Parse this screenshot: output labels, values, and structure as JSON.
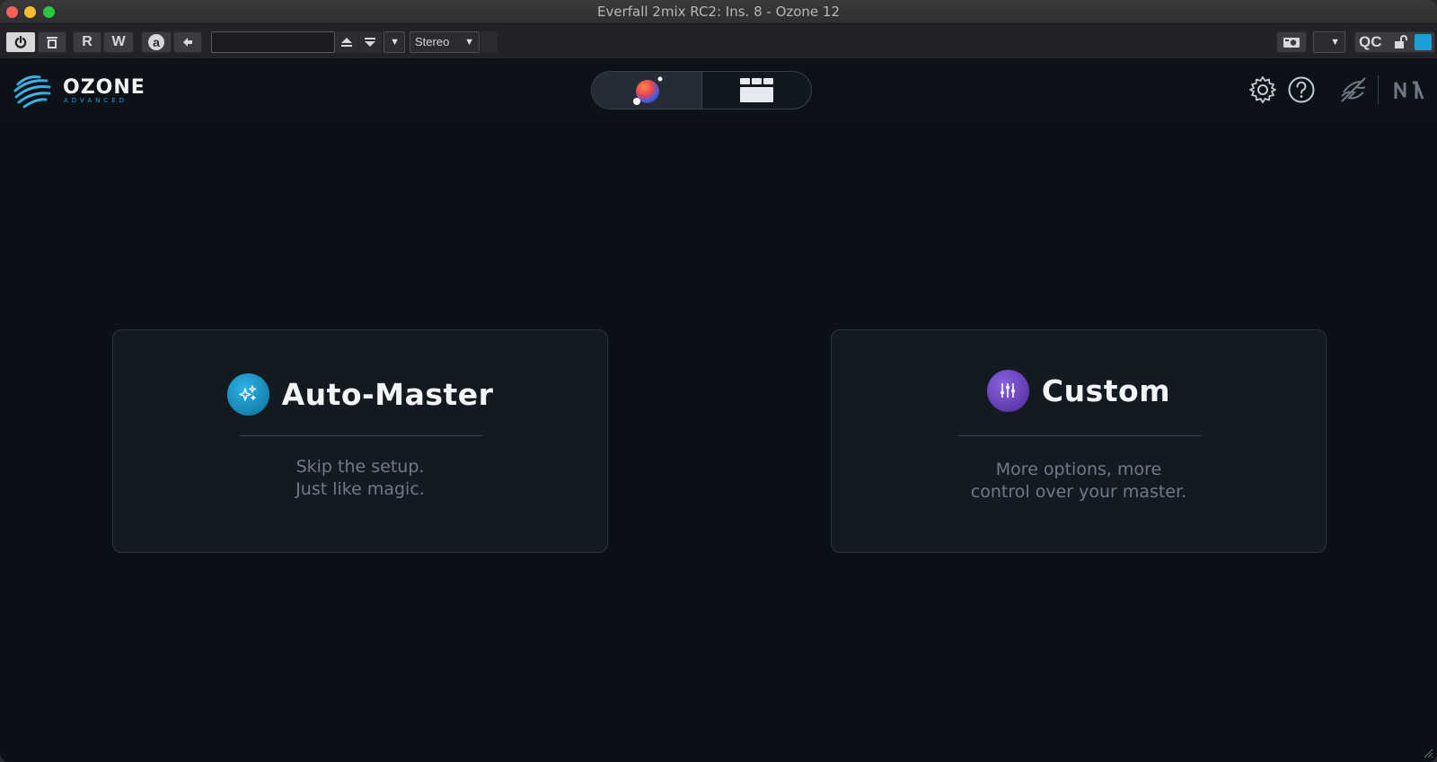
{
  "window": {
    "title": "Everfall 2mix RC2: Ins. 8 - Ozone 12"
  },
  "host_toolbar": {
    "read_label": "R",
    "write_label": "W",
    "auto_label": "a",
    "preset_value": "",
    "channel_mode": "Stereo",
    "compare_label": "QC",
    "accent_color": "#1a9fd6"
  },
  "plugin_header": {
    "logo_text": "OZONE",
    "logo_subtext": "ADVANCED",
    "modes": [
      {
        "name": "assistant",
        "icon": "orb-icon",
        "selected": true
      },
      {
        "name": "modules",
        "icon": "modules-grid-icon",
        "selected": false
      }
    ],
    "right_icons": [
      "gear-icon",
      "help-icon",
      "izotope-logo-icon",
      "ni-logo-icon"
    ]
  },
  "cards": [
    {
      "title": "Auto-Master",
      "icon": "sparkle-icon",
      "color": "#1a95c7",
      "description": [
        "Skip the setup.",
        "Just like magic."
      ]
    },
    {
      "title": "Custom",
      "icon": "faders-icon",
      "color": "#6a44b8",
      "description": [
        "More options, more",
        "control over your master."
      ]
    }
  ]
}
